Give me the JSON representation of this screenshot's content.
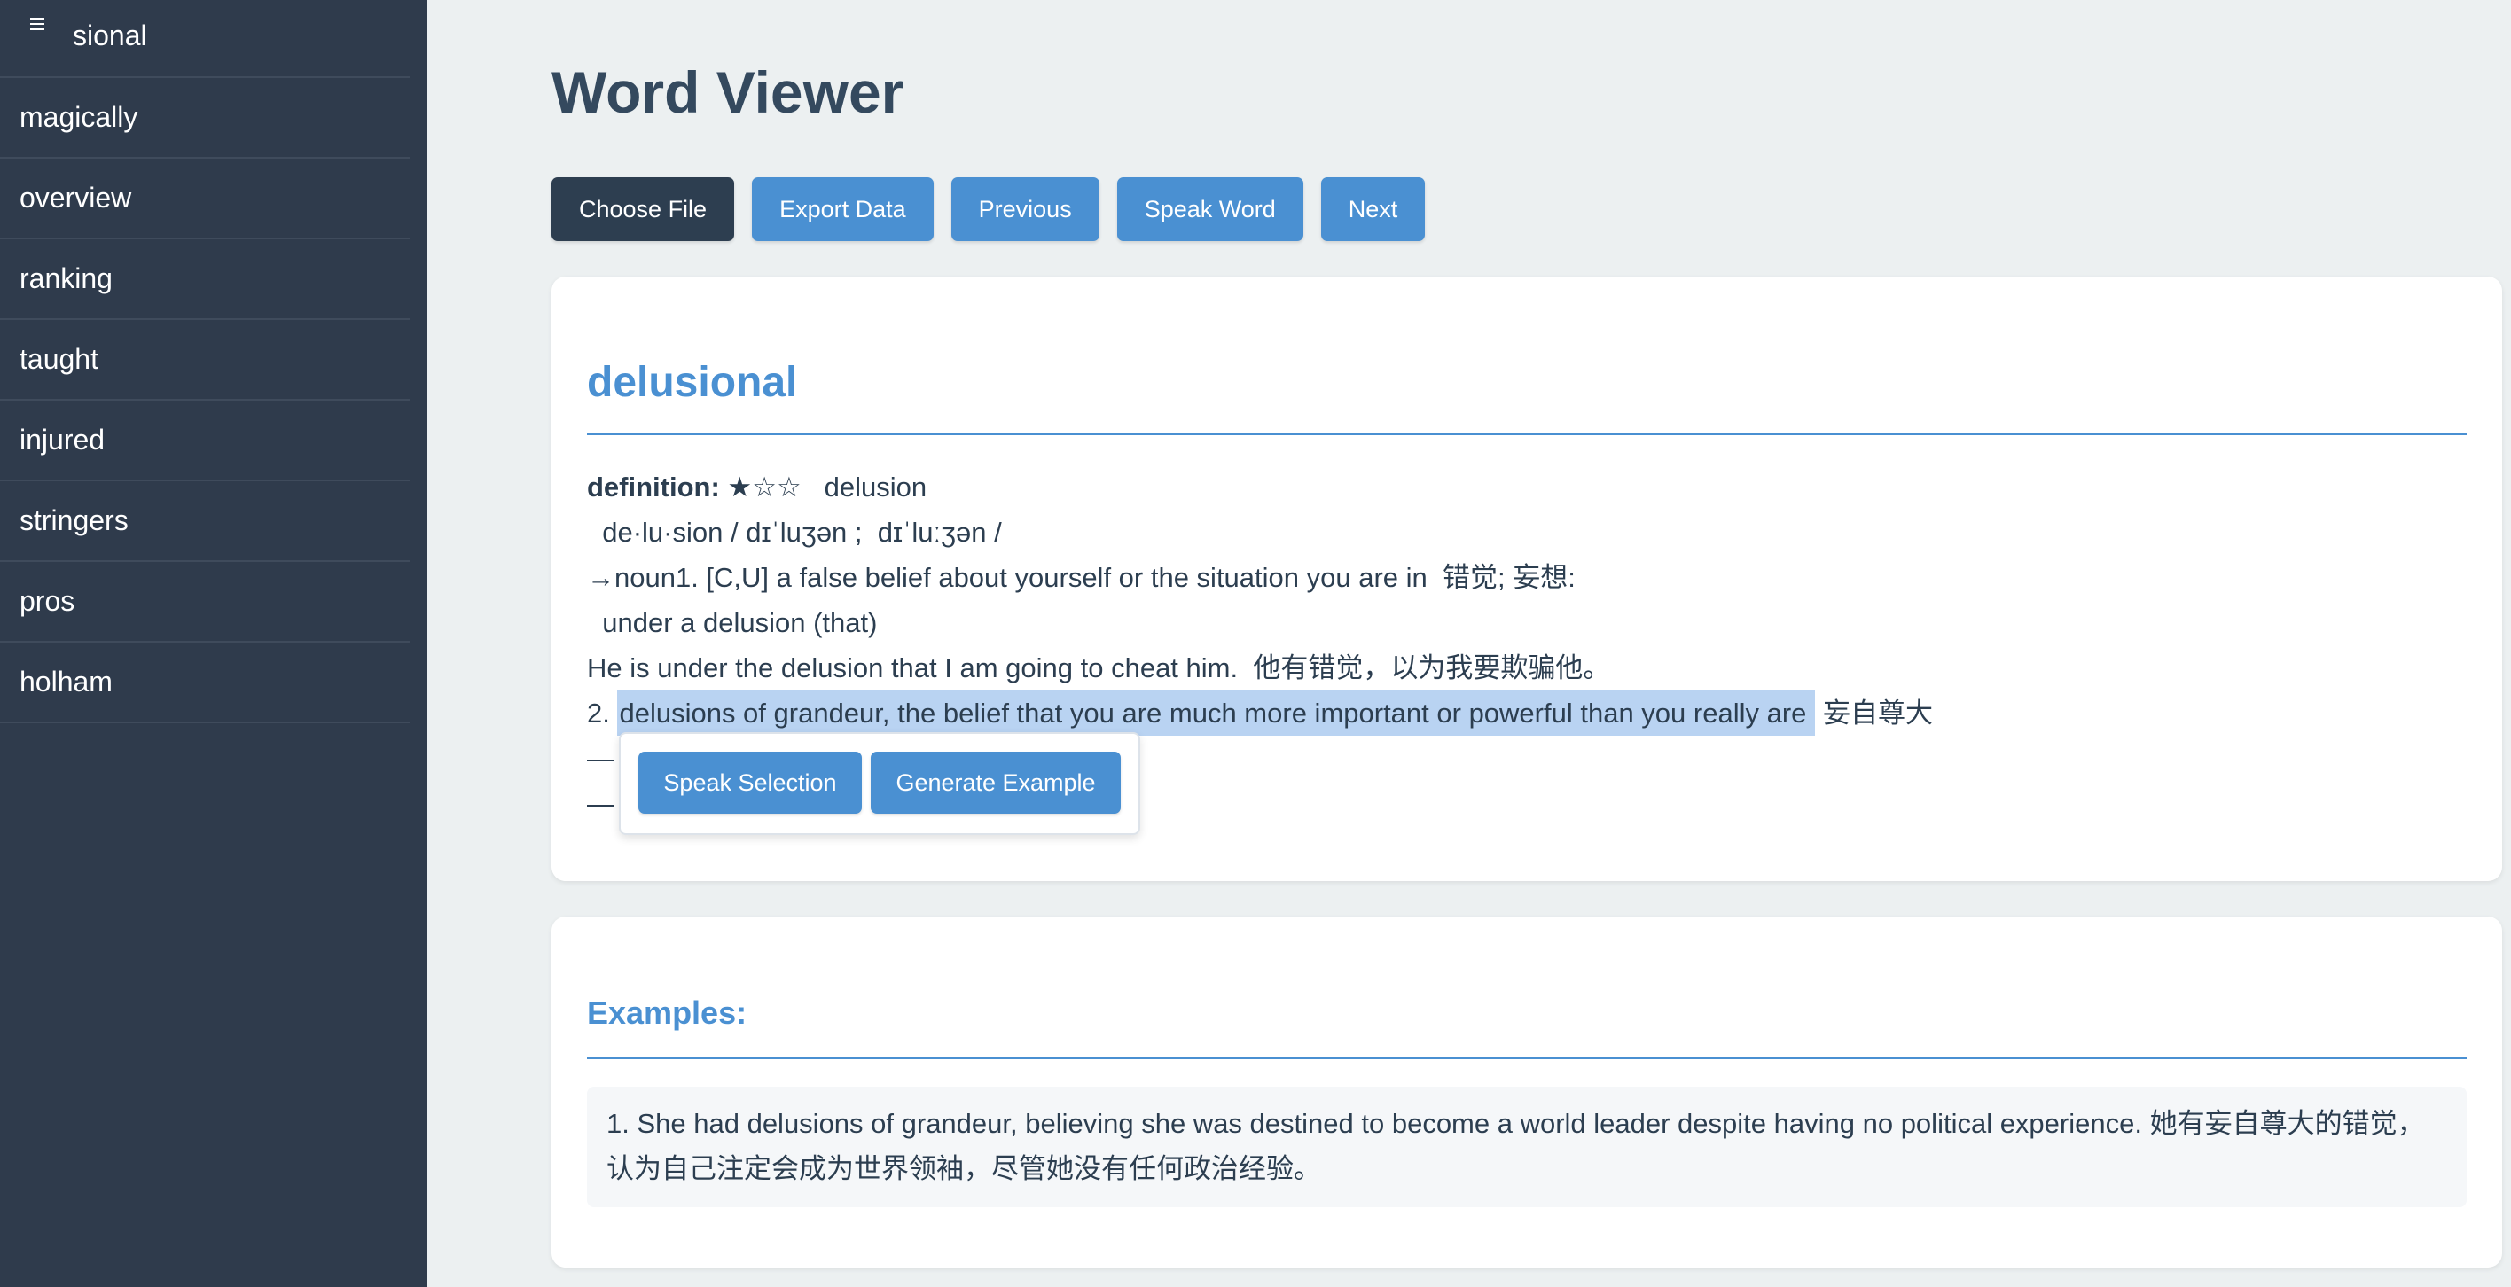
{
  "sidebar": {
    "menu_icon": "hamburger-menu-icon",
    "title": "sional",
    "items": [
      {
        "label": "magically"
      },
      {
        "label": "overview"
      },
      {
        "label": "ranking"
      },
      {
        "label": "taught"
      },
      {
        "label": "injured"
      },
      {
        "label": "stringers"
      },
      {
        "label": "pros"
      },
      {
        "label": "holham"
      }
    ]
  },
  "header": {
    "title": "Word Viewer"
  },
  "toolbar": {
    "choose_file": "Choose File",
    "export_data": "Export Data",
    "previous": "Previous",
    "speak_word": "Speak Word",
    "next": "Next"
  },
  "word": {
    "heading": "delusional",
    "definition_label": "definition:",
    "stars": "★☆☆",
    "headword": "delusion",
    "lines": [
      "de·lu·sion / dɪˈluʒən ;  dɪˈluːʒən /",
      "→noun1. [C,U] a false belief about yourself or the situation you are in  错觉; 妄想:",
      "under a delusion (that)",
      "He is under the delusion that I am going to cheat him.  他有错觉，以为我要欺骗他。"
    ],
    "line_prefix": "2. ",
    "highlighted": "delusions of grandeur, the belief that you are much more important or powerful than you really are",
    "line_suffix": "妄自尊大",
    "hidden_line_1": "—",
    "hidden_line_2": "—"
  },
  "selection_popup": {
    "speak_selection": "Speak Selection",
    "generate_example": "Generate Example"
  },
  "examples": {
    "heading": "Examples:",
    "items": [
      "1. She had delusions of grandeur, believing she was destined to become a world leader despite having no political experience. 她有妄自尊大的错觉，认为自己注定会成为世界领袖，尽管她没有任何政治经验。"
    ]
  },
  "colors": {
    "sidebar_bg": "#2f3b4c",
    "accent": "#4a90d2",
    "dark_button": "#2d3e50",
    "page_bg": "#ecf0f1",
    "highlight": "#b9d3f2"
  }
}
